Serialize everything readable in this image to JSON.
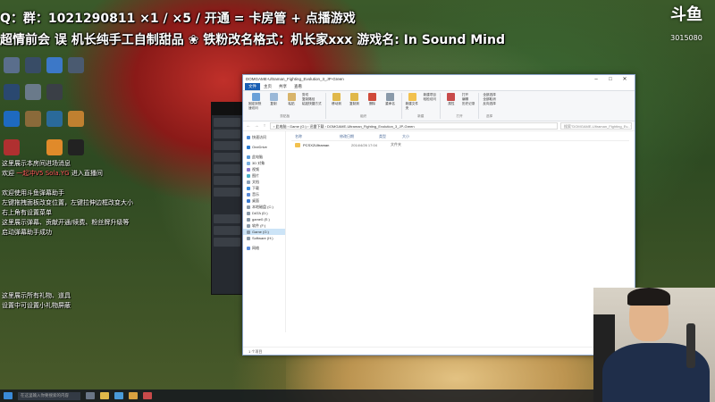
{
  "overlay": {
    "line1": "Q：群：1021290811 ×1 / ×5 / 开通 = 卡房管 + 点播游戏",
    "line2": "超情前会 误 机长纯手工自制甜品 ❀ 铁粉改名格式：机长家xxx 游戏名: In Sound Mind"
  },
  "stream_logo": {
    "name": "斗鱼",
    "room_id": "3015080"
  },
  "chat": [
    {
      "text": "这里展示本房间进场消息"
    },
    {
      "text": "欢迎 ",
      "hi": "一起冲V5 Sola.YG",
      "tail": " 进入直播间"
    },
    {
      "text": ""
    },
    {
      "text": "欢迎使用斗鱼弹幕助手"
    },
    {
      "text": "左键拖拽面板改变位置，左键拉伸边框改变大小"
    },
    {
      "text": "右上角有设置菜单"
    },
    {
      "text": "这里展示弹幕、贡献开通/续费、粉丝牌升级等"
    },
    {
      "text": "启动弹幕助手成功"
    },
    {
      "text": ""
    },
    {
      "text": "这里展示所有礼物、道具"
    },
    {
      "text": "设置中可设置小礼物屏蔽"
    }
  ],
  "explorer": {
    "title": "DOMGAME-Ultraman_Fighting_Evolution_3_JP-Green",
    "tabs": [
      "文件",
      "主页",
      "共享",
      "查看"
    ],
    "active_tab": "主页",
    "ribbon": {
      "clipboard": {
        "pin": "固定到快速访问",
        "copy": "复制",
        "paste": "粘贴",
        "cut": "剪切",
        "copy_path": "复制路径",
        "paste_shortcut": "粘贴快捷方式",
        "label": "剪贴板"
      },
      "organize": {
        "move_to": "移动到",
        "copy_to": "复制到",
        "delete": "删除",
        "rename": "重命名",
        "label": "组织"
      },
      "new": {
        "new_folder": "新建文件夹",
        "new_item": "新建项目",
        "easy_access": "轻松访问",
        "label": "新建"
      },
      "open": {
        "properties": "属性",
        "open": "打开",
        "edit": "编辑",
        "history": "历史记录",
        "label": "打开"
      },
      "select": {
        "select_all": "全部选择",
        "select_none": "全部取消",
        "invert": "反向选择",
        "label": "选择"
      }
    },
    "address": "› 此电脑 › Game (G:) › 迅雷下载 › DOMGAME-Ultraman_Fighting_Evolution_3_JP-Green",
    "search_placeholder": "搜索\"DOMGAME-Ultraman_Fighting_Ev...\"",
    "nav_items": [
      "快速访问",
      "OneDrive",
      "此电脑",
      "3D 对象",
      "视频",
      "图片",
      "文档",
      "下载",
      "音乐",
      "桌面",
      "本地磁盘 (C:)",
      "DATA (D:)",
      "game0 (E:)",
      "软件 (F:)",
      "Game (G:)",
      "Software (H:)",
      "网络"
    ],
    "selected_nav": "Game (G:)",
    "columns": [
      "名称",
      "修改日期",
      "类型",
      "大小"
    ],
    "files": [
      {
        "name": "PCSX2Ultraman",
        "date": "2014/4/26 17:04",
        "type": "文件夹"
      }
    ],
    "status": "1 个项目"
  },
  "taskbar": {
    "search_placeholder": "在这里输入你要搜索的内容"
  }
}
